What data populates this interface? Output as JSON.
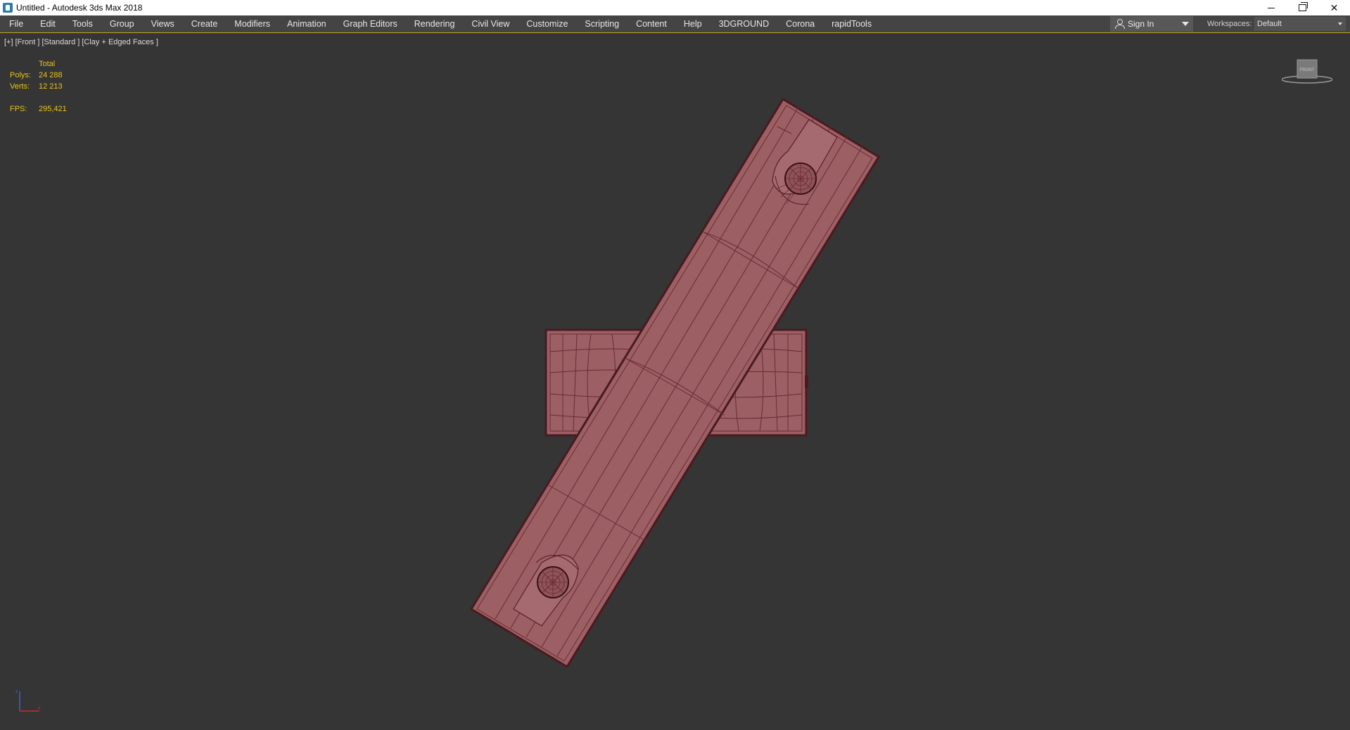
{
  "window": {
    "title": "Untitled - Autodesk 3ds Max 2018"
  },
  "menu": {
    "items": [
      "File",
      "Edit",
      "Tools",
      "Group",
      "Views",
      "Create",
      "Modifiers",
      "Animation",
      "Graph Editors",
      "Rendering",
      "Civil View",
      "Customize",
      "Scripting",
      "Content",
      "Help",
      "3DGROUND",
      "Corona",
      "rapidTools"
    ]
  },
  "account": {
    "sign_in_label": "Sign In"
  },
  "workspaces": {
    "label": "Workspaces:",
    "value": "Default"
  },
  "viewport": {
    "label": "[+] [Front ] [Standard ] [Clay + Edged Faces ]",
    "stats": {
      "header": "Total",
      "polys_label": "Polys:",
      "polys_value": "24 288",
      "verts_label": "Verts:",
      "verts_value": "12 213",
      "fps_label": "FPS:",
      "fps_value": "295,421"
    },
    "viewcube_label": "FRONT",
    "colors": {
      "background": "#353535",
      "model_fill": "#9b5f64",
      "model_edge": "#5a1e24",
      "stats_text": "#e8c41a"
    }
  }
}
